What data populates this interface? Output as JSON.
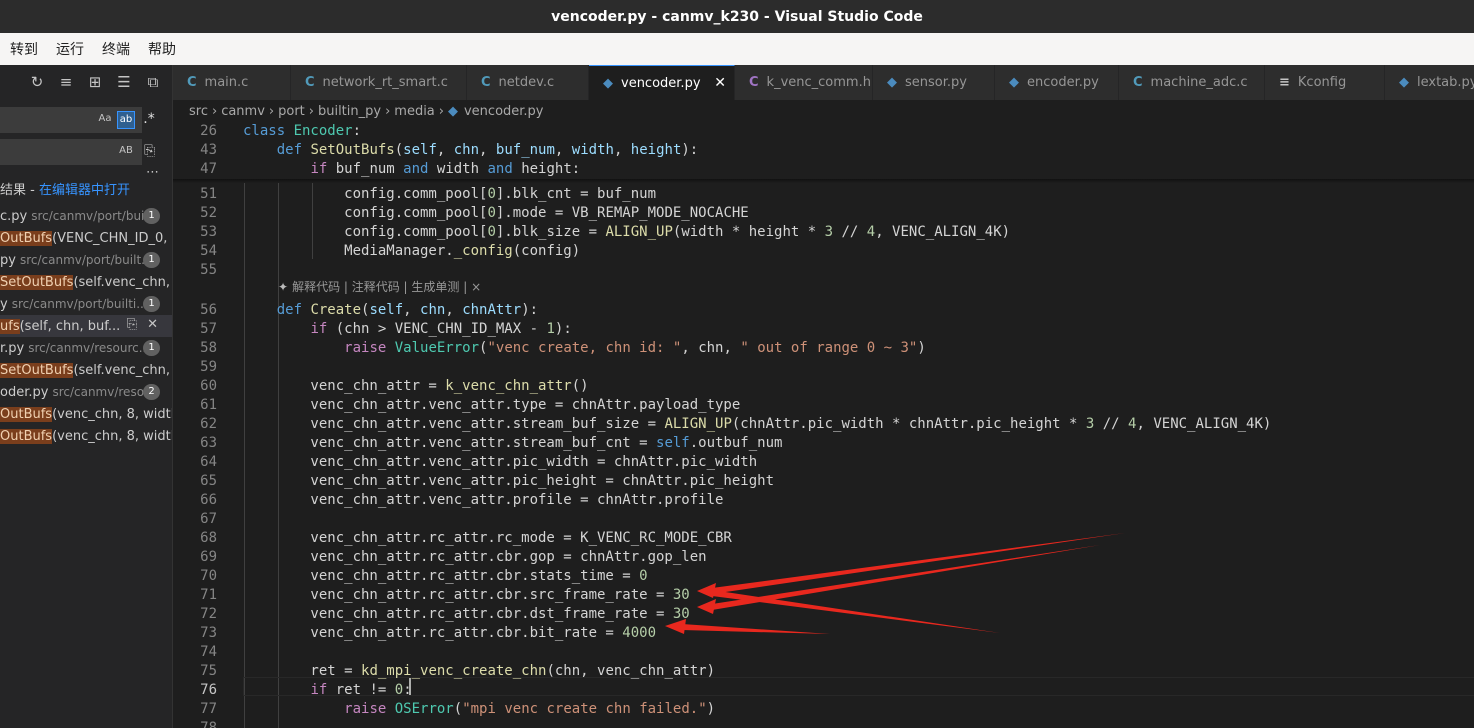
{
  "window": {
    "title": "vencoder.py - canmv_k230 - Visual Studio Code"
  },
  "menu": [
    {
      "label": "转到"
    },
    {
      "label": "运行"
    },
    {
      "label": "终端"
    },
    {
      "label": "帮助"
    }
  ],
  "search": {
    "match_case_label": "Aa",
    "whole_word_label": "ab",
    "regex_label": ".*",
    "preserve_case_label": "AB",
    "summary_prefix": "结果 - ",
    "open_in_editor_label": "在编辑器中打开",
    "results": [
      {
        "kind": "file",
        "name": "c.py",
        "path": "src/canmv/port/bui...",
        "count": "1"
      },
      {
        "kind": "match",
        "highlight": "OutBufs",
        "rest": "(VENC_CHN_ID_0, ..."
      },
      {
        "kind": "file",
        "name": "py",
        "path": "src/canmv/port/built...",
        "count": "1"
      },
      {
        "kind": "match",
        "highlight": "SetOutBufs",
        "rest": "(self.venc_chn, ..."
      },
      {
        "kind": "file",
        "name": "y",
        "path": "src/canmv/port/builti...",
        "count": "1"
      },
      {
        "kind": "match",
        "highlight": "ufs",
        "rest": "(self, chn, buf...",
        "selected": true
      },
      {
        "kind": "file",
        "name": "r.py",
        "path": "src/canmv/resourc...",
        "count": "1"
      },
      {
        "kind": "match",
        "highlight": "SetOutBufs",
        "rest": "(self.venc_chn, ..."
      },
      {
        "kind": "file",
        "name": "oder.py",
        "path": "src/canmv/reso...",
        "count": "2"
      },
      {
        "kind": "match",
        "highlight": "OutBufs",
        "rest": "(venc_chn, 8, width,..."
      },
      {
        "kind": "match",
        "highlight": "OutBufs",
        "rest": "(venc_chn, 8, width,..."
      }
    ]
  },
  "tabs": [
    {
      "icon": "C",
      "type": "c",
      "label": "main.c"
    },
    {
      "icon": "C",
      "type": "c",
      "label": "network_rt_smart.c"
    },
    {
      "icon": "C",
      "type": "c",
      "label": "netdev.c"
    },
    {
      "icon": "◆",
      "type": "py",
      "label": "vencoder.py",
      "active": true
    },
    {
      "icon": "C",
      "type": "h",
      "label": "k_venc_comm.h"
    },
    {
      "icon": "◆",
      "type": "py",
      "label": "sensor.py"
    },
    {
      "icon": "◆",
      "type": "py",
      "label": "encoder.py"
    },
    {
      "icon": "C",
      "type": "c",
      "label": "machine_adc.c"
    },
    {
      "icon": "≡",
      "type": "k",
      "label": "Kconfig"
    },
    {
      "icon": "◆",
      "type": "py",
      "label": "lextab.py"
    }
  ],
  "breadcrumb": [
    "src",
    "canmv",
    "port",
    "builtin_py",
    "media",
    "vencoder.py"
  ],
  "codelens": "解释代码 | 注释代码 | 生成单测 | ×",
  "sticky_lines": [
    {
      "n": "26",
      "tokens": [
        [
          "kw",
          "class "
        ],
        [
          "cls",
          "Encoder"
        ],
        [
          "",
          ":"
        ]
      ]
    },
    {
      "n": "43",
      "tokens": [
        [
          "",
          "    "
        ],
        [
          "kw",
          "def "
        ],
        [
          "fn",
          "SetOutBufs"
        ],
        [
          "",
          "("
        ],
        [
          "prm",
          "self"
        ],
        [
          "",
          ", "
        ],
        [
          "prm",
          "chn"
        ],
        [
          "",
          ", "
        ],
        [
          "prm",
          "buf_num"
        ],
        [
          "",
          ", "
        ],
        [
          "prm",
          "width"
        ],
        [
          "",
          ", "
        ],
        [
          "prm",
          "height"
        ],
        [
          "",
          "):"
        ]
      ]
    },
    {
      "n": "47",
      "tokens": [
        [
          "",
          "        "
        ],
        [
          "ctl",
          "if "
        ],
        [
          "",
          "buf_num "
        ],
        [
          "kw",
          "and "
        ],
        [
          "",
          "width "
        ],
        [
          "kw",
          "and "
        ],
        [
          "",
          "height:"
        ]
      ]
    }
  ],
  "code_lines": [
    {
      "n": "51",
      "tokens": [
        [
          "",
          "            config.comm_pool["
        ],
        [
          "num",
          "0"
        ],
        [
          "",
          "].blk_cnt = buf_num"
        ]
      ]
    },
    {
      "n": "52",
      "tokens": [
        [
          "",
          "            config.comm_pool["
        ],
        [
          "num",
          "0"
        ],
        [
          "",
          "].mode = VB_REMAP_MODE_NOCACHE"
        ]
      ]
    },
    {
      "n": "53",
      "tokens": [
        [
          "",
          "            config.comm_pool["
        ],
        [
          "num",
          "0"
        ],
        [
          "",
          "].blk_size = "
        ],
        [
          "fn",
          "ALIGN_UP"
        ],
        [
          "",
          "(width * height * "
        ],
        [
          "num",
          "3"
        ],
        [
          "",
          " // "
        ],
        [
          "num",
          "4"
        ],
        [
          "",
          ", VENC_ALIGN_4K)"
        ]
      ]
    },
    {
      "n": "54",
      "tokens": [
        [
          "",
          "            MediaManager."
        ],
        [
          "fn",
          "_config"
        ],
        [
          "",
          "(config)"
        ]
      ]
    },
    {
      "n": "55",
      "tokens": []
    },
    {
      "n": "56",
      "tokens": [
        [
          "",
          "    "
        ],
        [
          "kw",
          "def "
        ],
        [
          "fn",
          "Create"
        ],
        [
          "",
          "("
        ],
        [
          "prm",
          "self"
        ],
        [
          "",
          ", "
        ],
        [
          "prm",
          "chn"
        ],
        [
          "",
          ", "
        ],
        [
          "prm",
          "chnAttr"
        ],
        [
          "",
          "):"
        ]
      ]
    },
    {
      "n": "57",
      "tokens": [
        [
          "",
          "        "
        ],
        [
          "ctl",
          "if "
        ],
        [
          "",
          "(chn > VENC_CHN_ID_MAX - "
        ],
        [
          "num",
          "1"
        ],
        [
          "",
          "):"
        ]
      ]
    },
    {
      "n": "58",
      "tokens": [
        [
          "",
          "            "
        ],
        [
          "ctl",
          "raise "
        ],
        [
          "cls",
          "ValueError"
        ],
        [
          "",
          "("
        ],
        [
          "str",
          "\"venc create, chn id: \""
        ],
        [
          "",
          ", chn, "
        ],
        [
          "str",
          "\" out of range 0 ~ 3\""
        ],
        [
          "",
          ")"
        ]
      ]
    },
    {
      "n": "59",
      "tokens": []
    },
    {
      "n": "60",
      "tokens": [
        [
          "",
          "        venc_chn_attr = "
        ],
        [
          "fn",
          "k_venc_chn_attr"
        ],
        [
          "",
          "()"
        ]
      ]
    },
    {
      "n": "61",
      "tokens": [
        [
          "",
          "        venc_chn_attr.venc_attr.type = chnAttr.payload_type"
        ]
      ]
    },
    {
      "n": "62",
      "tokens": [
        [
          "",
          "        venc_chn_attr.venc_attr.stream_buf_size = "
        ],
        [
          "fn",
          "ALIGN_UP"
        ],
        [
          "",
          "(chnAttr.pic_width * chnAttr.pic_height * "
        ],
        [
          "num",
          "3"
        ],
        [
          "",
          " // "
        ],
        [
          "num",
          "4"
        ],
        [
          "",
          ", VENC_ALIGN_4K)"
        ]
      ]
    },
    {
      "n": "63",
      "tokens": [
        [
          "",
          "        venc_chn_attr.venc_attr.stream_buf_cnt = "
        ],
        [
          "kw",
          "self"
        ],
        [
          "",
          ".outbuf_num"
        ]
      ]
    },
    {
      "n": "64",
      "tokens": [
        [
          "",
          "        venc_chn_attr.venc_attr.pic_width = chnAttr.pic_width"
        ]
      ]
    },
    {
      "n": "65",
      "tokens": [
        [
          "",
          "        venc_chn_attr.venc_attr.pic_height = chnAttr.pic_height"
        ]
      ]
    },
    {
      "n": "66",
      "tokens": [
        [
          "",
          "        venc_chn_attr.venc_attr.profile = chnAttr.profile"
        ]
      ]
    },
    {
      "n": "67",
      "tokens": []
    },
    {
      "n": "68",
      "tokens": [
        [
          "",
          "        venc_chn_attr.rc_attr.rc_mode = K_VENC_RC_MODE_CBR"
        ]
      ]
    },
    {
      "n": "69",
      "tokens": [
        [
          "",
          "        venc_chn_attr.rc_attr.cbr.gop = chnAttr.gop_len"
        ]
      ]
    },
    {
      "n": "70",
      "tokens": [
        [
          "",
          "        venc_chn_attr.rc_attr.cbr.stats_time = "
        ],
        [
          "num",
          "0"
        ]
      ]
    },
    {
      "n": "71",
      "tokens": [
        [
          "",
          "        venc_chn_attr.rc_attr.cbr.src_frame_rate = "
        ],
        [
          "num",
          "30"
        ]
      ]
    },
    {
      "n": "72",
      "tokens": [
        [
          "",
          "        venc_chn_attr.rc_attr.cbr.dst_frame_rate = "
        ],
        [
          "num",
          "30"
        ]
      ]
    },
    {
      "n": "73",
      "tokens": [
        [
          "",
          "        venc_chn_attr.rc_attr.cbr.bit_rate = "
        ],
        [
          "num",
          "4000"
        ]
      ]
    },
    {
      "n": "74",
      "tokens": []
    },
    {
      "n": "75",
      "tokens": [
        [
          "",
          "        ret = "
        ],
        [
          "fn",
          "kd_mpi_venc_create_chn"
        ],
        [
          "",
          "(chn, venc_chn_attr)"
        ]
      ]
    },
    {
      "n": "76",
      "tokens": [
        [
          "",
          "        "
        ],
        [
          "ctl",
          "if "
        ],
        [
          "",
          "ret != "
        ],
        [
          "num",
          "0"
        ],
        [
          "",
          ":"
        ]
      ],
      "current": true
    },
    {
      "n": "77",
      "tokens": [
        [
          "",
          "            "
        ],
        [
          "ctl",
          "raise "
        ],
        [
          "cls",
          "OSError"
        ],
        [
          "",
          "("
        ],
        [
          "str",
          "\"mpi venc create chn failed.\""
        ],
        [
          "",
          ")"
        ]
      ]
    },
    {
      "n": "78",
      "tokens": []
    }
  ],
  "colors": {
    "accent": "#3794ff",
    "annotation_arrow": "#e8281e",
    "match_highlight": "#7a3e1c"
  }
}
